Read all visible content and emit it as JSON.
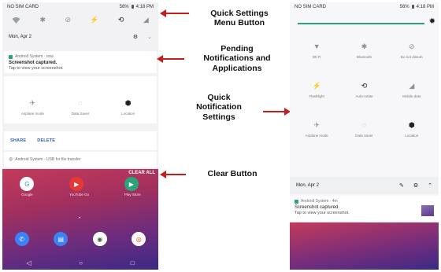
{
  "left": {
    "carrier": "NO SIM CARD",
    "battery": "56%",
    "time": "4:18 PM",
    "date": "Mon, Apr 2",
    "notification": {
      "app": "Android System · now",
      "title": "Screenshot captured.",
      "text": "Tap to view your screenshot."
    },
    "tiles": [
      "Airplane mode",
      "Data Saver",
      "Location"
    ],
    "actions": {
      "share": "SHARE",
      "delete": "DELETE"
    },
    "usb_notification": "Android System · USB for file transfer",
    "clear_all": "CLEAR ALL",
    "apps_row1": [
      "Google",
      "YouTube Go",
      "Play Store"
    ],
    "nav": {
      "back": "◁",
      "home": "○",
      "recents": "□"
    }
  },
  "right": {
    "carrier": "NO SIM CARD",
    "battery": "56%",
    "time": "4:18 PM",
    "tiles": [
      {
        "label": "Wi-Fi",
        "icon": "wifi-icon"
      },
      {
        "label": "Bluetooth",
        "icon": "bluetooth-icon"
      },
      {
        "label": "Do not disturb",
        "icon": "dnd-icon"
      },
      {
        "label": "Flashlight",
        "icon": "flashlight-icon"
      },
      {
        "label": "Auto-rotate",
        "icon": "rotate-icon"
      },
      {
        "label": "Mobile data",
        "icon": "mobile-data-icon"
      },
      {
        "label": "Airplane mode",
        "icon": "airplane-icon"
      },
      {
        "label": "Data Saver",
        "icon": "data-saver-icon"
      },
      {
        "label": "Location",
        "icon": "location-icon"
      }
    ],
    "date": "Mon, Apr 2",
    "notification": {
      "app": "Android System · 4m",
      "title": "Screenshot captured.",
      "text": "Tap to view your screenshot."
    }
  },
  "callouts": {
    "quick_settings_menu": "Quick Settings\nMenu Button",
    "pending": "Pending\nNotifications and\nApplications",
    "quick_notification": "Quick\nNotification\nSettings",
    "clear": "Clear Button"
  },
  "colors": {
    "arrow": "#c41e1e",
    "action_link": "#2d5da8",
    "wallpaper_top": "#c43a5c",
    "wallpaper_bottom": "#3b2a86"
  }
}
